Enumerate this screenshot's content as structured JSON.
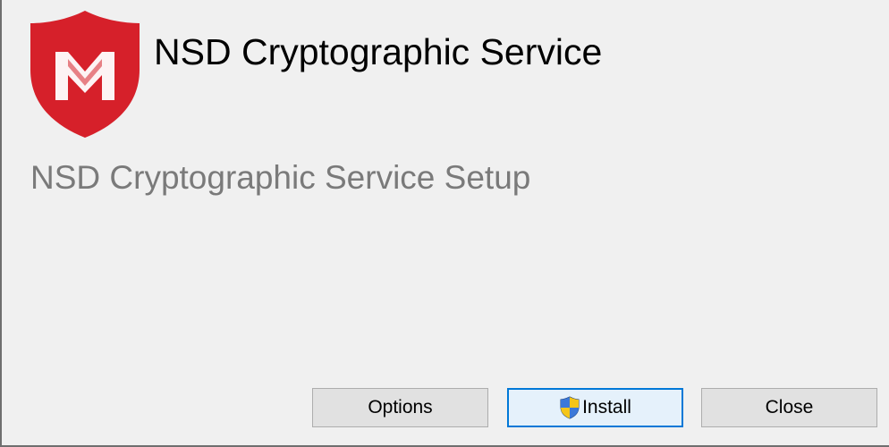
{
  "app": {
    "title": "NSD Cryptographic Service",
    "setup_heading": "NSD Cryptographic Service Setup",
    "logo_icon": "red-shield-logo-icon",
    "brand_color": "#d6202a"
  },
  "buttons": {
    "options_label": "Options",
    "install_label": "Install",
    "install_icon": "uac-shield-icon",
    "close_label": "Close"
  }
}
